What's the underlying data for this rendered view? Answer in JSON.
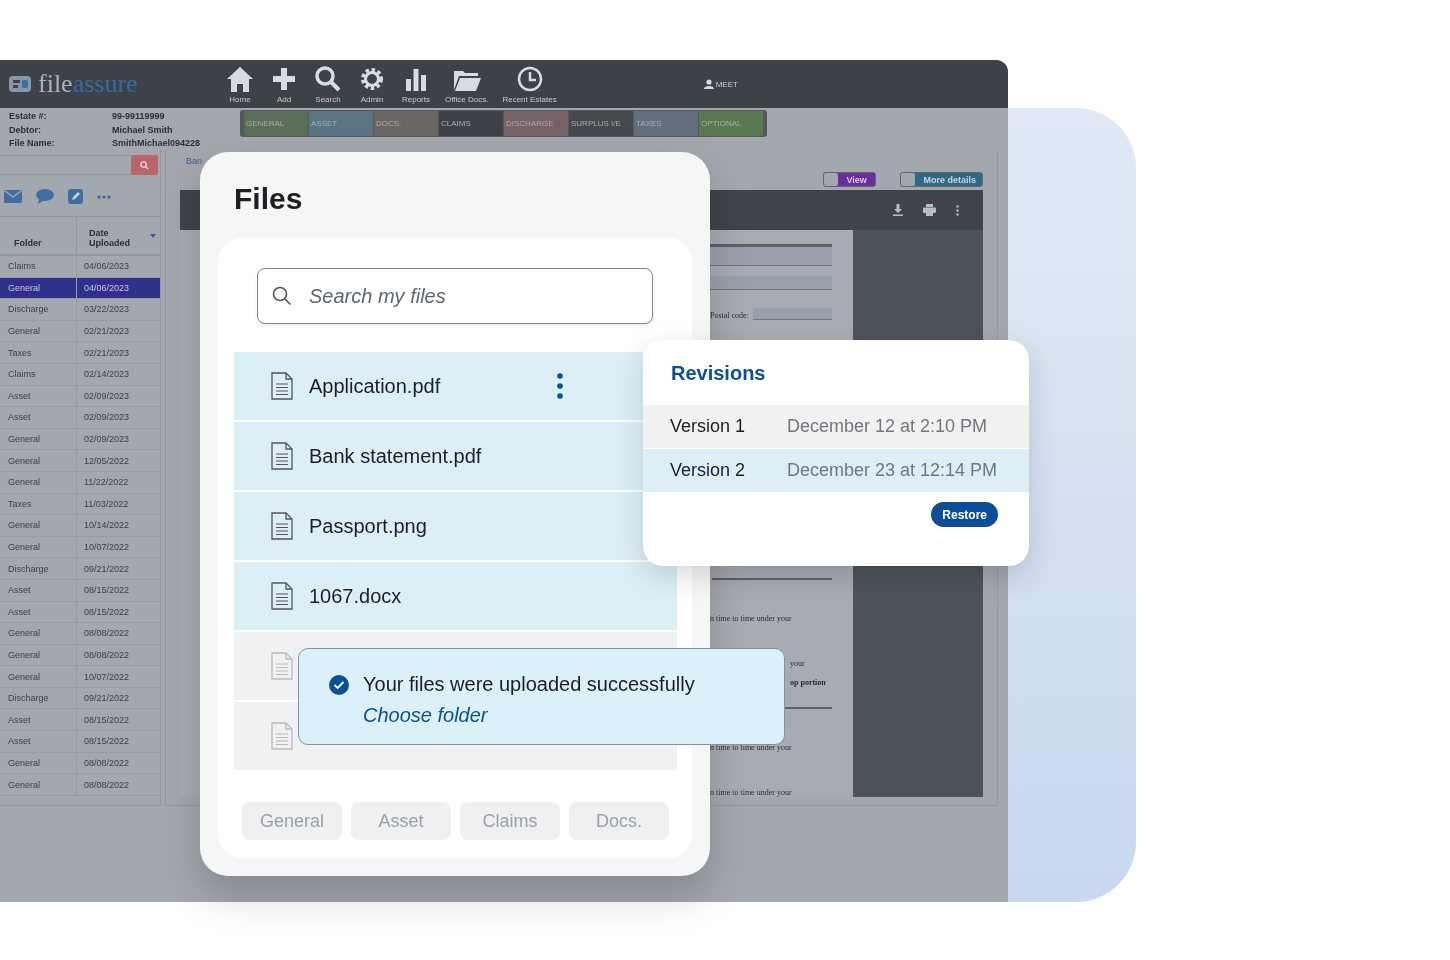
{
  "app": {
    "logo": {
      "part_1": "file",
      "part_2": "assure"
    },
    "nav": [
      {
        "label": "Home",
        "kind": "home"
      },
      {
        "label": "Add",
        "kind": "add"
      },
      {
        "label": "Search",
        "kind": "search"
      },
      {
        "label": "Admin",
        "kind": "admin"
      },
      {
        "label": "Reports",
        "kind": "reports"
      },
      {
        "label": "Office Docs.",
        "kind": "folder"
      },
      {
        "label": "Recent Estates",
        "kind": "clock"
      }
    ],
    "user": "MEET",
    "estate_info": [
      {
        "label": "Estate #:",
        "value": "99-99119999"
      },
      {
        "label": "Debtor:",
        "value": "Michael Smith"
      },
      {
        "label": "File Name:",
        "value": "SmithMichael094228"
      }
    ],
    "folder_tabs": [
      {
        "label": "GENERAL",
        "color": "#5a6e58"
      },
      {
        "label": "ASSET",
        "color": "#5b7484"
      },
      {
        "label": "DOCS.",
        "color": "#6c6662"
      },
      {
        "label": "CLAIMS",
        "color": "#3e4248"
      },
      {
        "label": "DISCHARGE",
        "color": "#756168"
      },
      {
        "label": "SURPLUS I/E",
        "color": "#45484d"
      },
      {
        "label": "TAXES",
        "color": "#646f7d"
      },
      {
        "label": "OPTIONAL",
        "color": "#5a7950"
      }
    ],
    "table": {
      "columns": [
        "Folder",
        "Date Uploaded"
      ],
      "rows": [
        {
          "folder": "Claims",
          "date": "04/06/2023",
          "selected": false
        },
        {
          "folder": "General",
          "date": "04/06/2023",
          "selected": true
        },
        {
          "folder": "Discharge",
          "date": "03/22/2023",
          "selected": false
        },
        {
          "folder": "General",
          "date": "02/21/2023",
          "selected": false
        },
        {
          "folder": "Taxes",
          "date": "02/21/2023",
          "selected": false
        },
        {
          "folder": "Claims",
          "date": "02/14/2023",
          "selected": false
        },
        {
          "folder": "Asset",
          "date": "02/09/2023",
          "selected": false
        },
        {
          "folder": "Asset",
          "date": "02/09/2023",
          "selected": false
        },
        {
          "folder": "General",
          "date": "02/09/2023",
          "selected": false
        },
        {
          "folder": "General",
          "date": "12/05/2022",
          "selected": false
        },
        {
          "folder": "General",
          "date": "11/22/2022",
          "selected": false
        },
        {
          "folder": "Taxes",
          "date": "11/03/2022",
          "selected": false
        },
        {
          "folder": "General",
          "date": "10/14/2022",
          "selected": false
        },
        {
          "folder": "General",
          "date": "10/07/2022",
          "selected": false
        },
        {
          "folder": "Discharge",
          "date": "09/21/2022",
          "selected": false
        },
        {
          "folder": "Asset",
          "date": "08/15/2022",
          "selected": false
        },
        {
          "folder": "Asset",
          "date": "08/15/2022",
          "selected": false
        },
        {
          "folder": "General",
          "date": "08/08/2022",
          "selected": false
        },
        {
          "folder": "General",
          "date": "08/08/2022",
          "selected": false
        },
        {
          "folder": "General",
          "date": "10/07/2022",
          "selected": false
        },
        {
          "folder": "Discharge",
          "date": "09/21/2022",
          "selected": false
        },
        {
          "folder": "Asset",
          "date": "08/15/2022",
          "selected": false
        },
        {
          "folder": "Asset",
          "date": "08/15/2022",
          "selected": false
        },
        {
          "folder": "General",
          "date": "08/08/2022",
          "selected": false
        },
        {
          "folder": "General",
          "date": "08/08/2022",
          "selected": false
        }
      ]
    },
    "breadcrumb": "Ban",
    "toggles": [
      {
        "label": "View",
        "on": false,
        "color": "#6a2e9c"
      },
      {
        "label": "More details",
        "on": false,
        "color": "#2e6a86"
      }
    ],
    "document_lines": [
      {
        "kind": "field"
      },
      {
        "kind": "field"
      },
      {
        "kind": "postal",
        "text": "Postal code:"
      },
      {
        "kind": "rule"
      },
      {
        "kind": "text",
        "text": "n time to time under your"
      },
      {
        "kind": "side",
        "text": "your"
      },
      {
        "kind": "bold",
        "text": "op portion"
      },
      {
        "kind": "rule"
      },
      {
        "kind": "text",
        "text": "n time to time under your"
      },
      {
        "kind": "text",
        "text": "n time to time under your"
      }
    ]
  },
  "files_panel": {
    "title": "Files",
    "search": {
      "placeholder": "Search my files"
    },
    "items": [
      {
        "name": "Application.pdf",
        "highlighted": true,
        "menu": true
      },
      {
        "name": "Bank statement.pdf",
        "highlighted": true,
        "menu": false
      },
      {
        "name": "Passport.png",
        "highlighted": true,
        "menu": false
      },
      {
        "name": "1067.docx",
        "highlighted": true,
        "menu": false
      },
      {
        "highlighted": false,
        "menu": false
      },
      {
        "highlighted": false,
        "menu": false
      }
    ],
    "folders": [
      "General",
      "Asset",
      "Claims",
      "Docs."
    ]
  },
  "revisions": {
    "title": "Revisions",
    "versions": [
      {
        "name": "Version 1",
        "date": "December 12 at 2:10 PM",
        "selected": false
      },
      {
        "name": "Version 2",
        "date": "December 23 at 12:14 PM",
        "selected": true
      }
    ],
    "button": "Restore"
  },
  "toast": {
    "message": "Your files were uploaded successfully",
    "link": "Choose folder"
  }
}
